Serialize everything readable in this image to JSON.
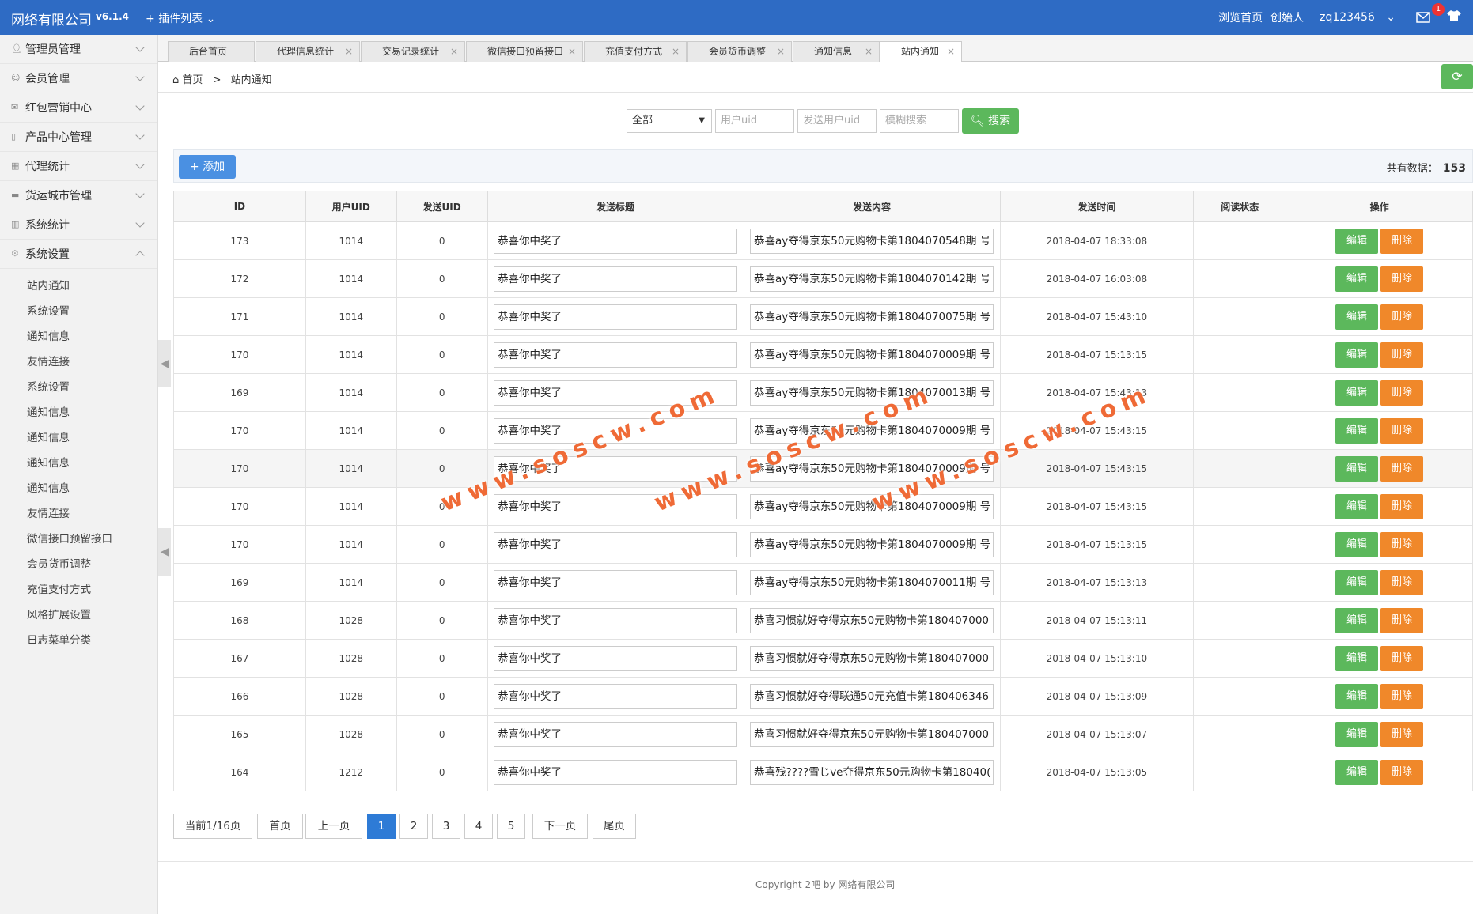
{
  "header": {
    "brand": "网络有限公司",
    "version": "v6.1.4",
    "plugin_menu": "插件列表",
    "browse_home": "浏览首页",
    "user_role": "创始人",
    "username": "zq123456",
    "notif_count": "1"
  },
  "sidebar": {
    "menus": [
      {
        "label": "管理员管理",
        "icon": "user-icon"
      },
      {
        "label": "会员管理",
        "icon": "member-icon"
      },
      {
        "label": "红包营销中心",
        "icon": "envelope-icon"
      },
      {
        "label": "产品中心管理",
        "icon": "file-icon"
      },
      {
        "label": "代理统计",
        "icon": "grid-icon"
      },
      {
        "label": "货运城市管理",
        "icon": "truck-icon"
      },
      {
        "label": "系统统计",
        "icon": "chart-icon"
      },
      {
        "label": "系统设置",
        "icon": "gear-icon"
      }
    ],
    "sub_items": [
      "站内通知",
      "系统设置",
      "通知信息",
      "友情连接",
      "系统设置",
      "通知信息",
      "通知信息",
      "通知信息",
      "通知信息",
      "友情连接",
      "微信接口预留接口",
      "会员货币调整",
      "充值支付方式",
      "风格扩展设置",
      "日志菜单分类"
    ]
  },
  "tabs": [
    "后台首页",
    "代理信息统计",
    "交易记录统计",
    "微信接口预留接口",
    "充值支付方式",
    "会员货币调整",
    "通知信息",
    "站内通知"
  ],
  "breadcrumb": {
    "home": "首页",
    "sep": ">",
    "current": "站内通知"
  },
  "filters": {
    "select_value": "全部",
    "uid_placeholder": "用户uid",
    "send_uid_placeholder": "发送用户uid",
    "fuzzy_placeholder": "模糊搜索",
    "search_label": "搜索"
  },
  "toolbar": {
    "add_label": "添加",
    "total_label": "共有数据：",
    "total_value": "153"
  },
  "table": {
    "headers": [
      "ID",
      "用户UID",
      "发送UID",
      "发送标题",
      "发送内容",
      "发送时间",
      "阅读状态",
      "操作"
    ],
    "edit_label": "编辑",
    "delete_label": "删除",
    "rows": [
      {
        "id": "173",
        "uid": "1014",
        "send_uid": "0",
        "title": "恭喜你中奖了",
        "content": "恭喜ay夺得京东50元购物卡第1804070548期 号",
        "time": "2018-04-07 18:33:08",
        "status": ""
      },
      {
        "id": "172",
        "uid": "1014",
        "send_uid": "0",
        "title": "恭喜你中奖了",
        "content": "恭喜ay夺得京东50元购物卡第1804070142期 号",
        "time": "2018-04-07 16:03:08",
        "status": ""
      },
      {
        "id": "171",
        "uid": "1014",
        "send_uid": "0",
        "title": "恭喜你中奖了",
        "content": "恭喜ay夺得京东50元购物卡第1804070075期 号",
        "time": "2018-04-07 15:43:10",
        "status": ""
      },
      {
        "id": "170",
        "uid": "1014",
        "send_uid": "0",
        "title": "恭喜你中奖了",
        "content": "恭喜ay夺得京东50元购物卡第1804070009期 号",
        "time": "2018-04-07 15:13:15",
        "status": ""
      },
      {
        "id": "169",
        "uid": "1014",
        "send_uid": "0",
        "title": "恭喜你中奖了",
        "content": "恭喜ay夺得京东50元购物卡第1804070013期 号",
        "time": "2018-04-07 15:43:13",
        "status": ""
      },
      {
        "id": "170",
        "uid": "1014",
        "send_uid": "0",
        "title": "恭喜你中奖了",
        "content": "恭喜ay夺得京东50元购物卡第1804070009期 号",
        "time": "2018-04-07 15:43:15",
        "status": ""
      },
      {
        "id": "170",
        "uid": "1014",
        "send_uid": "0",
        "title": "恭喜你中奖了",
        "content": "恭喜ay夺得京东50元购物卡第1804070009期 号",
        "time": "2018-04-07 15:43:15",
        "status": ""
      },
      {
        "id": "170",
        "uid": "1014",
        "send_uid": "0",
        "title": "恭喜你中奖了",
        "content": "恭喜ay夺得京东50元购物卡第1804070009期 号",
        "time": "2018-04-07 15:43:15",
        "status": ""
      },
      {
        "id": "170",
        "uid": "1014",
        "send_uid": "0",
        "title": "恭喜你中奖了",
        "content": "恭喜ay夺得京东50元购物卡第1804070009期 号",
        "time": "2018-04-07 15:13:15",
        "status": ""
      },
      {
        "id": "169",
        "uid": "1014",
        "send_uid": "0",
        "title": "恭喜你中奖了",
        "content": "恭喜ay夺得京东50元购物卡第1804070011期 号",
        "time": "2018-04-07 15:13:13",
        "status": ""
      },
      {
        "id": "168",
        "uid": "1028",
        "send_uid": "0",
        "title": "恭喜你中奖了",
        "content": "恭喜习惯就好夺得京东50元购物卡第180407000",
        "time": "2018-04-07 15:13:11",
        "status": ""
      },
      {
        "id": "167",
        "uid": "1028",
        "send_uid": "0",
        "title": "恭喜你中奖了",
        "content": "恭喜习惯就好夺得京东50元购物卡第180407000",
        "time": "2018-04-07 15:13:10",
        "status": ""
      },
      {
        "id": "166",
        "uid": "1028",
        "send_uid": "0",
        "title": "恭喜你中奖了",
        "content": "恭喜习惯就好夺得联通50元充值卡第180406346",
        "time": "2018-04-07 15:13:09",
        "status": ""
      },
      {
        "id": "165",
        "uid": "1028",
        "send_uid": "0",
        "title": "恭喜你中奖了",
        "content": "恭喜习惯就好夺得京东50元购物卡第180407000",
        "time": "2018-04-07 15:13:07",
        "status": ""
      },
      {
        "id": "164",
        "uid": "1212",
        "send_uid": "0",
        "title": "恭喜你中奖了",
        "content": "恭喜残????雪じve夺得京东50元购物卡第18040(",
        "time": "2018-04-07 15:13:05",
        "status": ""
      }
    ]
  },
  "pagination": {
    "current_info": "当前1/16页",
    "first": "首页",
    "prev": "上一页",
    "pages": [
      "1",
      "2",
      "3",
      "4",
      "5"
    ],
    "next": "下一页",
    "last": "尾页"
  },
  "footer": {
    "copyright": "Copyright 2吧 by 网络有限公司"
  },
  "watermark": {
    "text": "www.soscw.com"
  },
  "colors": {
    "primary": "#2e6bc4",
    "success": "#5cb85c",
    "danger": "#f0882a",
    "pager_active": "#2e7bd6"
  }
}
